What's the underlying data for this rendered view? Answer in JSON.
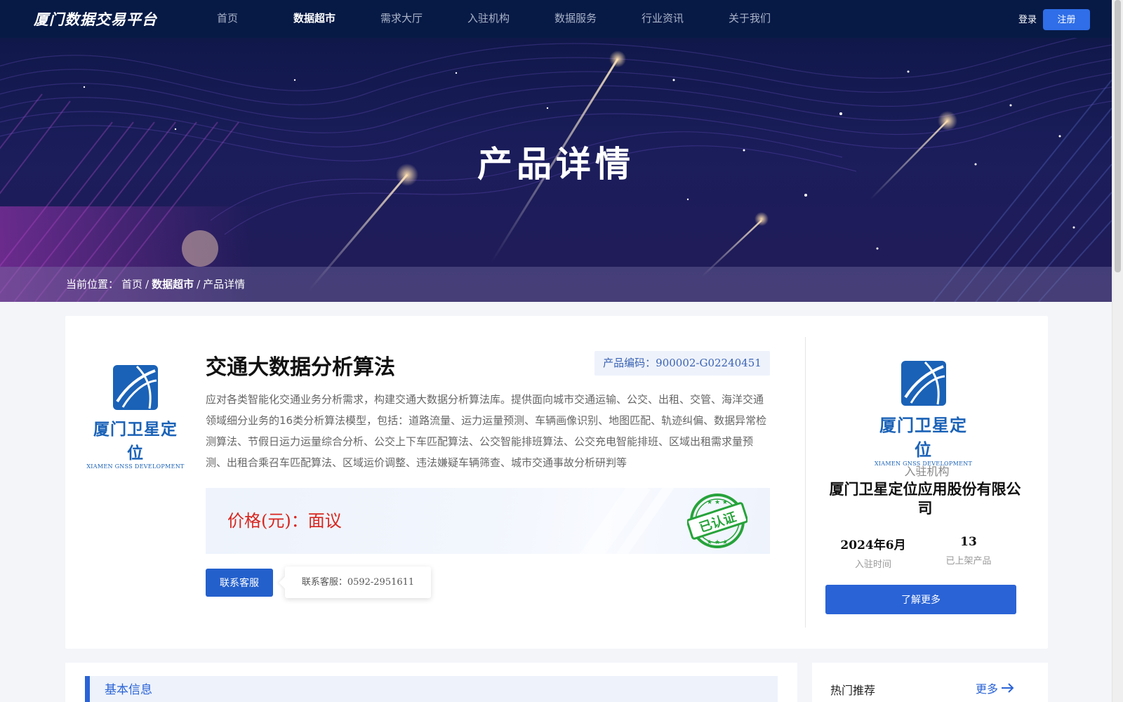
{
  "nav": {
    "brand": "厦门数据交易平台",
    "items": [
      "首页",
      "数据超市",
      "需求大厅",
      "入驻机构",
      "数据服务",
      "行业资讯",
      "关于我们"
    ],
    "login": "登录",
    "register": "注册"
  },
  "hero": {
    "title": "产品详情",
    "breadcrumb": {
      "prefix": "当前位置：",
      "home": "首页",
      "sep": "/",
      "market": "数据超市",
      "current": "产品详情"
    }
  },
  "product": {
    "logo_cn": "厦门卫星定位",
    "logo_en": "XIAMEN GNSS DEVELOPMENT",
    "title": "交通大数据分析算法",
    "code": "产品编码：900002-G02240451",
    "description": "应对各类智能化交通业务分析需求，构建交通大数据分析算法库。提供面向城市交通运输、公交、出租、交管、海洋交通领域细分业务的16类分析算法模型，包括：道路流量、运力运量预测、车辆画像识别、地图匹配、轨迹纠偏、数据异常检测算法、节假日运力运量综合分析、公交上下车匹配算法、公交智能排班算法、公交充电智能排班、区域出租需求量预测、出租合乘召车匹配算法、区域运价调整、违法嫌疑车辆筛查、城市交通事故分析研判等",
    "price": "价格(元)：面议",
    "certified": "已认证",
    "contact_button": "联系客服",
    "contact_tip": "联系客服：0592-2951611"
  },
  "org": {
    "logo_cn": "厦门卫星定位",
    "logo_en": "XIAMEN GNSS DEVELOPMENT",
    "tag": "入驻机构",
    "name": "厦门卫星定位应用股份有限公司",
    "join_time_value": "2024年6月",
    "join_time_label": "入驻时间",
    "products_value": "13",
    "products_label": "已上架产品",
    "more_button": "了解更多"
  },
  "sections": {
    "basic_info": "基本信息",
    "hot": "热门推荐",
    "more": "更多"
  },
  "colors": {
    "primary": "#2a63d6",
    "nav_bg": "#071a46",
    "price": "#d8261f",
    "stamp": "#26a33a",
    "logo_blue": "#1a62b7"
  }
}
